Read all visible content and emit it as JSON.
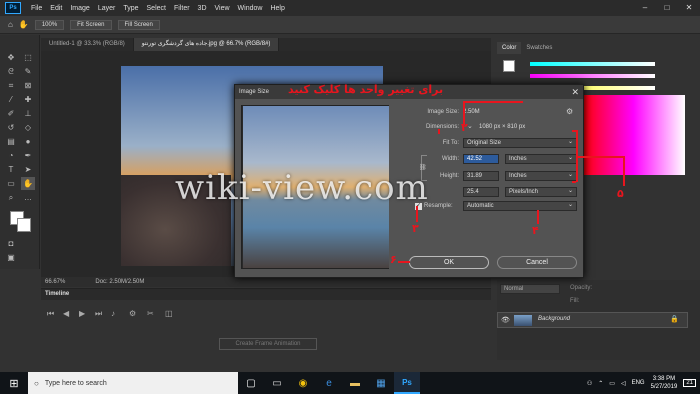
{
  "menubar": {
    "logo": "Ps",
    "items": [
      "File",
      "Edit",
      "Image",
      "Layer",
      "Type",
      "Select",
      "Filter",
      "3D",
      "View",
      "Window",
      "Help"
    ]
  },
  "window_controls": {
    "minimize": "–",
    "maximize": "□",
    "close": "✕"
  },
  "options_bar": {
    "zoom": "100%",
    "fit_screen": "Fit Screen",
    "fill_screen": "Fill Screen"
  },
  "doc_tabs": [
    {
      "label": "Untitled-1 @ 33.3% (RGB/8)"
    },
    {
      "label": "جاده های گردشگری تورنتو.jpg @ 66.7% (RGB/8#)"
    }
  ],
  "status_bar": {
    "zoom": "66.67%",
    "doc": "Doc: 2.50M/2.50M"
  },
  "timeline": {
    "title": "Timeline",
    "create_btn": "Create Frame Animation"
  },
  "color_panel": {
    "tabs": [
      "Color",
      "Swatches"
    ],
    "accent": "#31a8ff"
  },
  "layers": {
    "layer_name": "Background",
    "kind": "Normal",
    "opacity_label": "Opacity:",
    "fill_label": "Fill:"
  },
  "dialog": {
    "title": "Image Size",
    "image_size_label": "Image Size:",
    "image_size_value": "2.50M",
    "dimensions_label": "Dimensions:",
    "dimensions_value": "1080 px  ×  810 px",
    "fit_to_label": "Fit To:",
    "fit_to_value": "Original Size",
    "width_label": "Width:",
    "width_value": "42.52",
    "width_unit": "Inches",
    "height_label": "Height:",
    "height_value": "31.89",
    "height_unit": "Inches",
    "resolution_value": "25.4",
    "resolution_unit": "Pixels/Inch",
    "resample_label": "Resample:",
    "resample_value": "Automatic",
    "ok": "OK",
    "cancel": "Cancel"
  },
  "annotations": {
    "instruction": "برای تغییر واحد ها کلیک کنید",
    "n2": "۲",
    "n3": "۳",
    "n4": "۴",
    "n5": "۵",
    "n6": "۶"
  },
  "watermark": "wiki-view.com",
  "taskbar": {
    "search_placeholder": "Type here to search",
    "language": "ENG",
    "time": "3:38 PM",
    "date": "5/27/2019",
    "notifications": "21"
  }
}
